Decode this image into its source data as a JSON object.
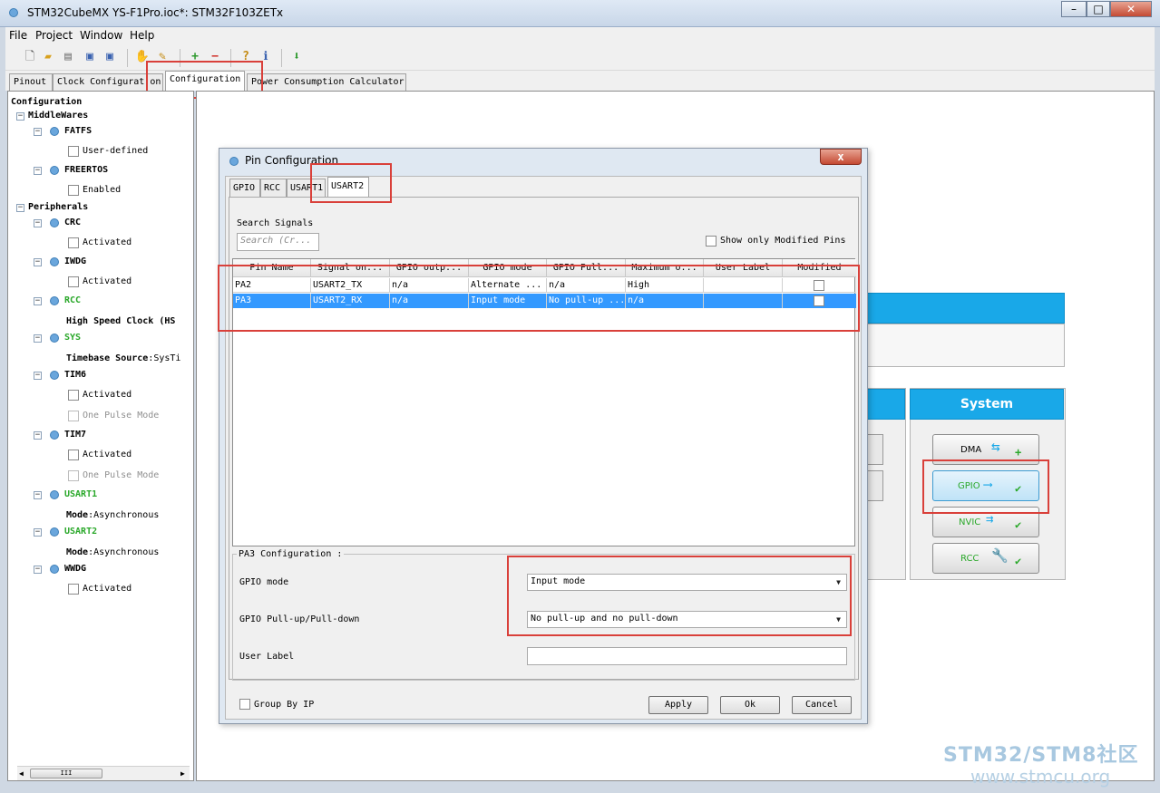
{
  "window": {
    "title": "STM32CubeMX YS-F1Pro.ioc*: STM32F103ZETx",
    "minimize": "–",
    "maximize": "□",
    "close": "✕"
  },
  "menu": [
    "File",
    "Project",
    "Window",
    "Help"
  ],
  "toolbar_icons": [
    "new-project-icon",
    "open-icon",
    "copy-icon",
    "save-icon",
    "save-as-icon",
    "import-icon",
    "load-icon",
    "add-icon",
    "remove-icon",
    "help-icon",
    "about-icon",
    "generate-code-icon"
  ],
  "main_tabs": [
    "Pinout",
    "Clock Configurat on",
    "Configuration",
    "Power Consumption Calculator"
  ],
  "tree": {
    "root": "Configuration",
    "middlewares": "MiddleWares",
    "fatfs": "FATFS",
    "user_defined": "User-defined",
    "freertos": "FREERTOS",
    "enabled": "Enabled",
    "peripherals": "Peripherals",
    "crc": "CRC",
    "activated": "Activated",
    "iwdg": "IWDG",
    "rcc": "RCC",
    "hsc_label": "High Speed Clock (HS",
    "sys": "SYS",
    "timebase_label": "Timebase Source",
    "timebase_value": ":SysTi",
    "tim6": "TIM6",
    "one_pulse": "One Pulse Mode",
    "tim7": "TIM7",
    "usart1": "USART1",
    "mode_label": "Mode",
    "async_value": ":Asynchronous",
    "usart2": "USART2",
    "wwdg": "WWDG",
    "scroll_grip": "III"
  },
  "system_panel": {
    "title": "System",
    "dma": "DMA",
    "gpio": "GPIO",
    "nvic": "NVIC",
    "rcc": "RCC"
  },
  "dialog": {
    "title": "Pin Configuration",
    "close": "x",
    "tabs": [
      "GPIO",
      "RCC",
      "USART1",
      "USART2"
    ],
    "search_label": "Search Signals",
    "search_placeholder": "Search (Cr...",
    "show_modified_label": "Show only Modified Pins",
    "columns": [
      "Pin Name",
      "Signal on...",
      "GPIO outp...",
      "GPIO mode",
      "GPIO Pull...",
      "Maximum o...",
      "User Label",
      "Modified"
    ],
    "rows": [
      [
        "PA2",
        "USART2_TX",
        "n/a",
        "Alternate ...",
        "n/a",
        "High",
        "",
        ""
      ],
      [
        "PA3",
        "USART2_RX",
        "n/a",
        "Input mode",
        "No pull-up ...",
        "n/a",
        "",
        ""
      ]
    ],
    "config_title": "PA3 Configuration :",
    "gpio_mode_label": "GPIO mode",
    "gpio_mode_value": "Input mode",
    "pull_label": "GPIO Pull-up/Pull-down",
    "pull_value": "No pull-up and no pull-down",
    "user_label_label": "User Label",
    "user_label_value": "",
    "group_by_ip": "Group By IP",
    "apply": "Apply",
    "ok": "Ok",
    "cancel": "Cancel"
  },
  "watermark": {
    "line1": "STM32/STM8社区",
    "line2": "www.stmcu.org"
  },
  "colors": {
    "accent_blue": "#19a8e8",
    "highlight_red": "#d9403a",
    "tree_green": "#2aa82a",
    "selection": "#3399ff"
  }
}
